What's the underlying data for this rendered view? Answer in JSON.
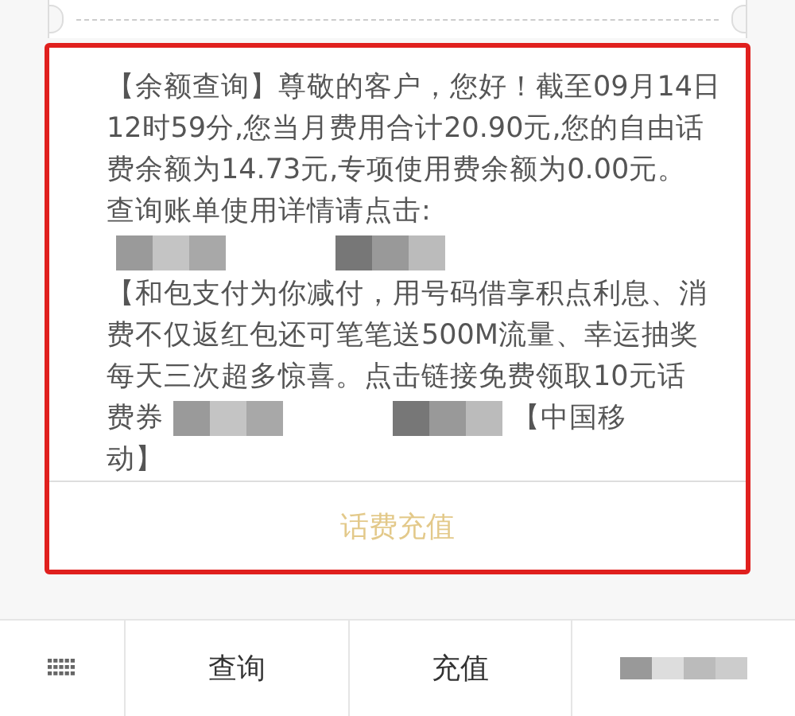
{
  "message": {
    "lines": [
      [
        {
          "kind": "text",
          "text": "【余额查询】尊敬的客户，您好！截至09月14日"
        }
      ],
      [
        {
          "kind": "text",
          "text": "12时59分,您当月费用合计20.90元,您的自由话"
        }
      ],
      [
        {
          "kind": "text",
          "text": "费余额为14.73元,专项使用费余额为0.00元。"
        }
      ],
      [
        {
          "kind": "text",
          "text": "查询账单使用详情请点击:"
        }
      ],
      [
        {
          "kind": "redaction"
        }
      ],
      [
        {
          "kind": "text",
          "text": "【和包支付为你减付，用号码借享积点利息、消"
        }
      ],
      [
        {
          "kind": "text",
          "text": "费不仅返红包还可笔笔送500M流量、幸运抽奖"
        }
      ],
      [
        {
          "kind": "text",
          "text": "每天三次超多惊喜。点击链接免费领取10元话"
        }
      ],
      [
        {
          "kind": "text",
          "text": "费券"
        },
        {
          "kind": "redaction"
        },
        {
          "kind": "text",
          "text": "【中国移"
        }
      ],
      [
        {
          "kind": "text",
          "text": "动】"
        }
      ]
    ]
  },
  "action_button": "话费充值",
  "bottom_menu": {
    "items": [
      {
        "kind": "keyboard"
      },
      {
        "kind": "text",
        "label": "查询"
      },
      {
        "kind": "text",
        "label": "充值"
      },
      {
        "kind": "redaction"
      }
    ]
  }
}
